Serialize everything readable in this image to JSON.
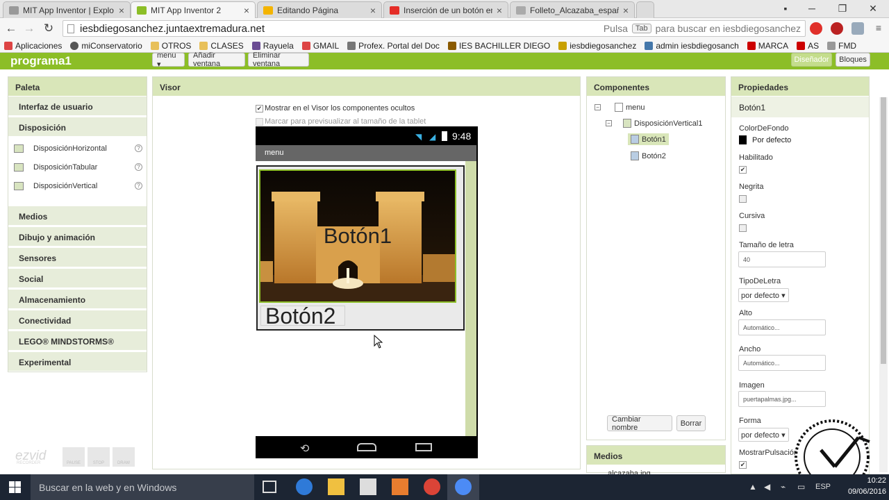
{
  "browser": {
    "tabs": [
      {
        "label": "MIT App Inventor | Explo",
        "icon_color": "#999999"
      },
      {
        "label": "MIT App Inventor 2",
        "icon_color": "#8cbe27"
      },
      {
        "label": "Editando Página",
        "icon_color": "#f4b400"
      },
      {
        "label": "Inserción de un botón en",
        "icon_color": "#e52d27"
      },
      {
        "label": "Folleto_Alcazaba_españo",
        "icon_color": "#aaaaaa"
      }
    ],
    "active_tab": 1,
    "url": "iesbdiegosanchez.juntaextremadura.net",
    "search_hint_prefix": "Pulsa",
    "search_hint_key": "Tab",
    "search_hint_suffix": "para buscar en iesbdiegosanchez",
    "bookmarks": [
      {
        "label": "Aplicaciones",
        "icon": "apps-icon",
        "color": "#d44"
      },
      {
        "label": "miConservatorio",
        "icon": "c-icon",
        "color": "#333"
      },
      {
        "label": "OTROS",
        "icon": "folder-icon",
        "color": "#e8c05a"
      },
      {
        "label": "CLASES",
        "icon": "folder-icon",
        "color": "#e8c05a"
      },
      {
        "label": "Rayuela",
        "icon": "rayuela-icon",
        "color": "#6a4c93"
      },
      {
        "label": "GMAIL",
        "icon": "gmail-icon",
        "color": "#d44"
      },
      {
        "label": "Profex. Portal del Doc",
        "icon": "star-icon",
        "color": "#555"
      },
      {
        "label": "IES BACHILLER DIEGO",
        "icon": "school-icon",
        "color": "#8a5a00"
      },
      {
        "label": "iesbdiegosanchez",
        "icon": "puzzle-icon",
        "color": "#c8a000"
      },
      {
        "label": "admin iesbdiegosanch",
        "icon": "joomla-icon",
        "color": "#4477aa"
      },
      {
        "label": "MARCA",
        "icon": "marca-icon",
        "color": "#c00"
      },
      {
        "label": "AS",
        "icon": "as-icon",
        "color": "#c00"
      },
      {
        "label": "FMD",
        "icon": "doc-icon",
        "color": "#999"
      }
    ]
  },
  "app": {
    "project_name": "programa1",
    "screen_menu_label": "menu ▾",
    "add_screen_label": "Añadir ventana",
    "remove_screen_label": "Eliminar ventana",
    "designer_label": "Diseñador",
    "blocks_label": "Bloques"
  },
  "palette": {
    "title": "Paleta",
    "categories_top": [
      "Interfaz de usuario",
      "Disposición"
    ],
    "items": [
      "DisposiciónHorizontal",
      "DisposiciónTabular",
      "DisposiciónVertical"
    ],
    "categories_bottom": [
      "Medios",
      "Dibujo y animación",
      "Sensores",
      "Social",
      "Almacenamiento",
      "Conectividad",
      "LEGO® MINDSTORMS®",
      "Experimental"
    ]
  },
  "viewer": {
    "title": "Visor",
    "show_hidden_label": "Mostrar en el Visor los componentes ocultos",
    "tablet_preview_label": "Marcar para previsualizar al tamaño de la tablet",
    "phone_time": "9:48",
    "screen_title": "menu",
    "button1_text": "Botón1",
    "button2_text": "Botón2"
  },
  "components": {
    "title": "Componentes",
    "tree": [
      "menu",
      "DisposiciónVertical1",
      "Botón1",
      "Botón2"
    ],
    "rename_label": "Cambiar nombre",
    "delete_label": "Borrar",
    "media_title": "Medios",
    "media_item": "alcazaba.jpg"
  },
  "properties": {
    "title": "Propiedades",
    "component": "Botón1",
    "bgcolor_label": "ColorDeFondo",
    "bgcolor_value": "Por defecto",
    "enabled_label": "Habilitado",
    "bold_label": "Negrita",
    "italic_label": "Cursiva",
    "fontsize_label": "Tamaño de letra",
    "fontsize_value": "40",
    "fonttype_label": "TipoDeLetra",
    "fonttype_value": "por defecto ▾",
    "height_label": "Alto",
    "height_value": "Automático...",
    "width_label": "Ancho",
    "width_value": "Automático...",
    "image_label": "Imagen",
    "image_value": "puertapalmas.jpg...",
    "shape_label": "Forma",
    "shape_value": "por defecto ▾",
    "show_feedback_label": "MostrarPulsación"
  },
  "taskbar": {
    "search_placeholder": "Buscar en la web y en Windows",
    "time": "10:22",
    "date": "09/06/2016",
    "lang": "ESP"
  },
  "watermark": {
    "brand": "ezvid",
    "sub": "RECORDER",
    "buttons": [
      "PAUSE",
      "STOP",
      "DRAW"
    ]
  }
}
